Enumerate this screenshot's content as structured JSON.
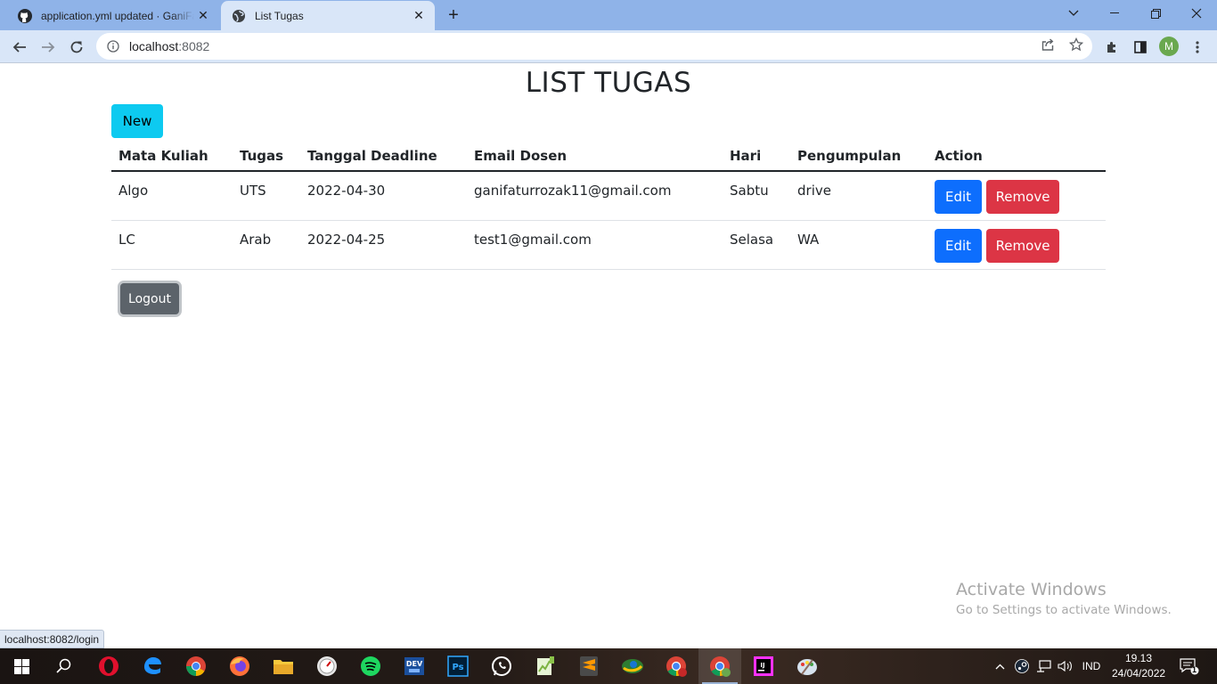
{
  "browser": {
    "tabs": [
      {
        "title": "application.yml updated · GaniFaturrozak",
        "active": false,
        "icon": "github-icon"
      },
      {
        "title": "List Tugas",
        "active": true,
        "icon": "globe-icon"
      }
    ],
    "url_host": "localhost",
    "url_port": ":8082",
    "profile_initial": "M",
    "status_url": "localhost:8082/login"
  },
  "page": {
    "title": "LIST TUGAS",
    "new_label": "New",
    "logout_label": "Logout",
    "columns": [
      "Mata Kuliah",
      "Tugas",
      "Tanggal Deadline",
      "Email Dosen",
      "Hari",
      "Pengumpulan",
      "Action"
    ],
    "rows": [
      {
        "mata_kuliah": "Algo",
        "tugas": "UTS",
        "deadline": "2022-04-30",
        "email": "ganifaturrozak11@gmail.com",
        "hari": "Sabtu",
        "pengumpulan": "drive",
        "edit": "Edit",
        "remove": "Remove"
      },
      {
        "mata_kuliah": "LC",
        "tugas": "Arab",
        "deadline": "2022-04-25",
        "email": "test1@gmail.com",
        "hari": "Selasa",
        "pengumpulan": "WA",
        "edit": "Edit",
        "remove": "Remove"
      }
    ]
  },
  "watermark": {
    "line1": "Activate Windows",
    "line2": "Go to Settings to activate Windows."
  },
  "taskbar": {
    "apps": [
      "start-icon",
      "search-icon",
      "opera-icon",
      "edge-icon",
      "chrome-icon",
      "firefox-icon",
      "file-explorer-icon",
      "clock-app-icon",
      "spotify-icon",
      "devcpp-icon",
      "photoshop-icon",
      "whatsapp-icon",
      "notepad-plus-icon",
      "sublime-icon",
      "network-app-icon",
      "chrome-profile-icon",
      "chrome-active-icon",
      "intellij-icon",
      "paint-icon"
    ],
    "language": "IND",
    "time": "19.13",
    "date": "24/04/2022",
    "notification_count": "1"
  },
  "colors": {
    "btn_new": "#0dcaf0",
    "btn_edit": "#0d6efd",
    "btn_remove": "#dc3545",
    "btn_logout": "#5c636a"
  }
}
